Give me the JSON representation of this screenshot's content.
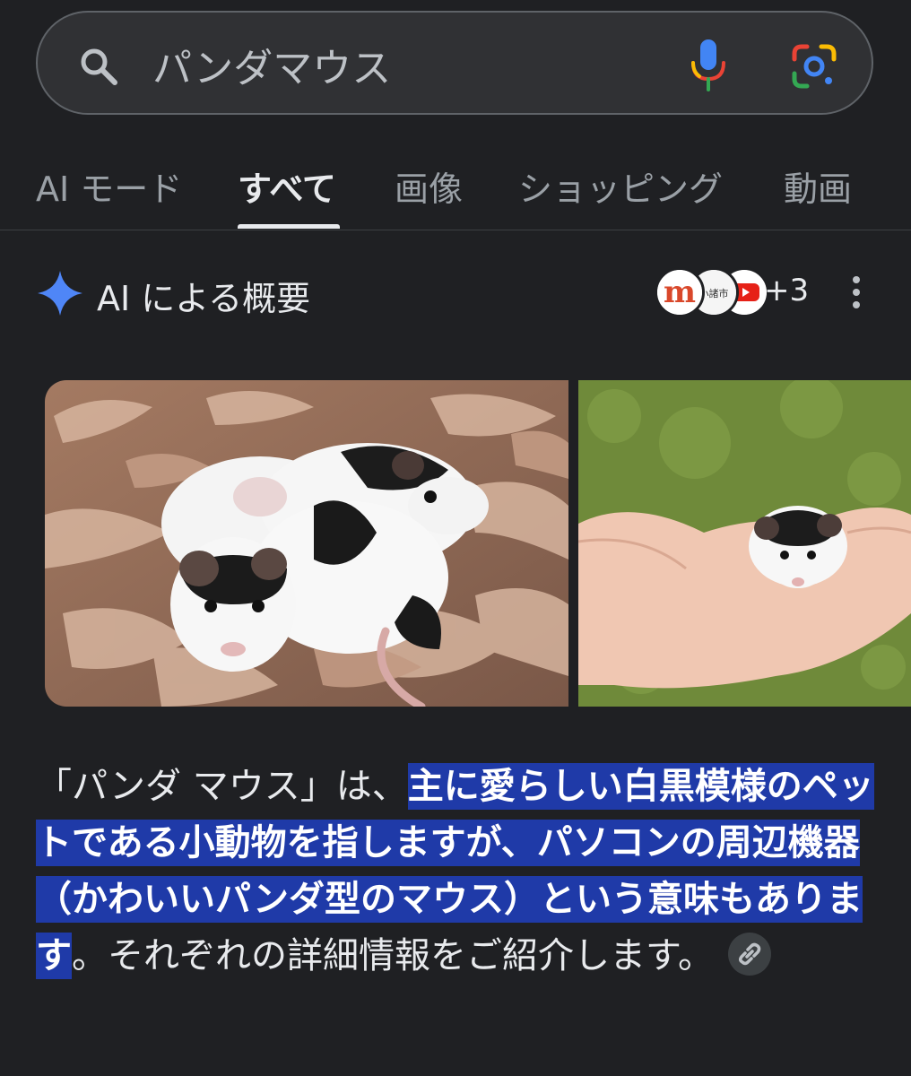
{
  "search": {
    "query": "パンダマウス"
  },
  "tabs": [
    {
      "label": "AI モード",
      "active": false
    },
    {
      "label": "すべて",
      "active": true
    },
    {
      "label": "画像",
      "active": false
    },
    {
      "label": "ショッピング",
      "active": false
    },
    {
      "label": "動画",
      "active": false
    }
  ],
  "ai_overview": {
    "title": "AI による概要",
    "source_count": "+3",
    "sources": [
      {
        "icon": "mercari-logo-icon",
        "text": "m"
      },
      {
        "icon": "city-logo-icon",
        "text": "小諸市"
      },
      {
        "icon": "youtube-logo-icon"
      }
    ],
    "images": [
      {
        "icon": "panda-mice-in-bedding-image"
      },
      {
        "icon": "panda-mouse-on-hand-image"
      }
    ],
    "summary": {
      "intro": "「パンダ マウス」は、",
      "highlight": "主に愛らしい白黒模様のペットである小動物を指しますが、パソコンの周辺機器（かわいいパンダ型のマウス）という意味もあります",
      "outro": "。それぞれの詳細情報をご紹介します。"
    }
  },
  "colors": {
    "background": "#1f2023",
    "highlight": "#1f3aa8",
    "sparkle": "#4f86f7"
  }
}
